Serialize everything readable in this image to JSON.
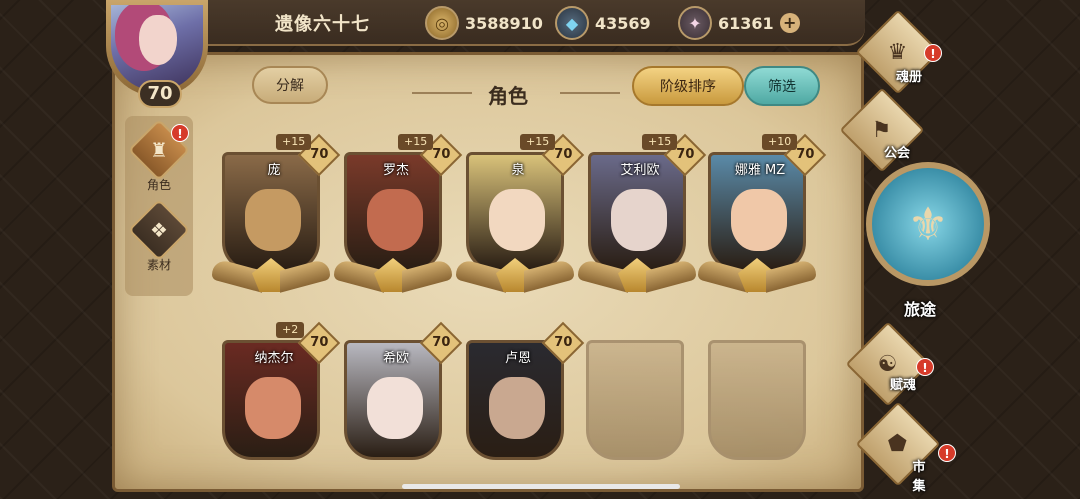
{
  "player": {
    "name": "遗像六十七",
    "level": "70"
  },
  "currencies": [
    {
      "name": "gold",
      "icon": "gold-coin-icon",
      "value": "3588910"
    },
    {
      "name": "crystal",
      "icon": "blue-crystal-icon",
      "value": "43569"
    },
    {
      "name": "gem",
      "icon": "pink-gem-icon",
      "value": "61361"
    }
  ],
  "header": {
    "title": "角色",
    "decompose_label": "分解",
    "sort_label": "阶级排序",
    "filter_label": "筛选"
  },
  "side_tabs": [
    {
      "label": "角色",
      "icon": "character-icon",
      "alert": "!"
    },
    {
      "label": "素材",
      "icon": "material-icon"
    }
  ],
  "characters": [
    {
      "name": "庞",
      "level": "70",
      "bonus": "+15",
      "color": "#8a6a48",
      "face": "#c59a62"
    },
    {
      "name": "罗杰",
      "level": "70",
      "bonus": "+15",
      "color": "#7a3a2a",
      "face": "#c26b4f"
    },
    {
      "name": "泉",
      "level": "70",
      "bonus": "+15",
      "color": "#d9c27a",
      "face": "#f2d8c0"
    },
    {
      "name": "艾利欧",
      "level": "70",
      "bonus": "+15",
      "color": "#6a6a8a",
      "face": "#e6d4cc"
    },
    {
      "name": "娜雅 MZ",
      "level": "70",
      "bonus": "+10",
      "color": "#5a8aa8",
      "face": "#f0c8a8"
    },
    {
      "name": "纳杰尔",
      "level": "70",
      "bonus": "+2",
      "color": "#6a2a22",
      "face": "#d68a6a"
    },
    {
      "name": "希欧",
      "level": "70",
      "color": "#b8b8c0",
      "face": "#f2e0d8"
    },
    {
      "name": "卢恩",
      "level": "70",
      "color": "#2a2a30",
      "face": "#c9a890"
    }
  ],
  "right_nav": [
    {
      "label": "魂册",
      "icon": "soul-book-icon",
      "alert": "!"
    },
    {
      "label": "公会",
      "icon": "guild-icon"
    },
    {
      "label": "旅途",
      "icon": "journey-icon"
    },
    {
      "label": "赋魂",
      "icon": "infuse-icon",
      "alert": "!"
    },
    {
      "label": "市集",
      "icon": "market-icon",
      "alert": "!"
    }
  ]
}
